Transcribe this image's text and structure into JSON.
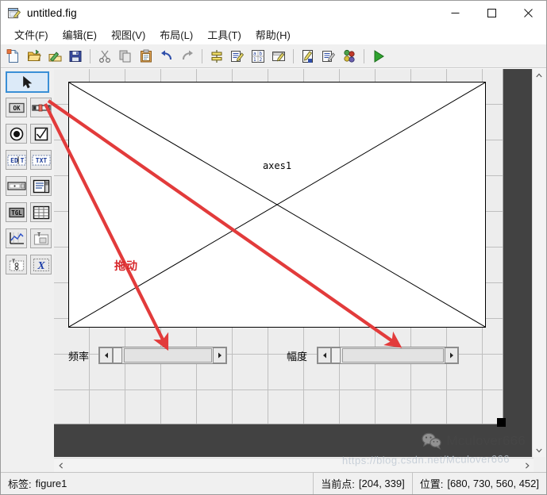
{
  "window": {
    "title": "untitled.fig",
    "icon": "figure-file-icon",
    "minimize": "─",
    "maximize": "□",
    "close": "✕"
  },
  "menubar": {
    "items": [
      {
        "label": "文件(F)",
        "name": "menu-file"
      },
      {
        "label": "编辑(E)",
        "name": "menu-edit"
      },
      {
        "label": "视图(V)",
        "name": "menu-view"
      },
      {
        "label": "布局(L)",
        "name": "menu-layout"
      },
      {
        "label": "工具(T)",
        "name": "menu-tools"
      },
      {
        "label": "帮助(H)",
        "name": "menu-help"
      }
    ]
  },
  "toolbar": {
    "buttons": [
      {
        "name": "new-file-icon",
        "tip": "新建"
      },
      {
        "name": "open-file-icon",
        "tip": "打开"
      },
      {
        "name": "export-icon",
        "tip": "导出"
      },
      {
        "name": "save-icon",
        "tip": "保存"
      },
      {
        "name": "cut-icon",
        "tip": "剪切"
      },
      {
        "name": "copy-icon",
        "tip": "复制"
      },
      {
        "name": "paste-icon",
        "tip": "粘贴"
      },
      {
        "name": "undo-icon",
        "tip": "撤销"
      },
      {
        "name": "redo-icon",
        "tip": "恢复"
      },
      {
        "name": "align-objects-icon",
        "tip": "对齐对象"
      },
      {
        "name": "menu-editor-icon",
        "tip": "菜单编辑器"
      },
      {
        "name": "tab-order-editor-icon",
        "tip": "Tab 顺序编辑器"
      },
      {
        "name": "toolbar-editor-icon",
        "tip": "工具栏编辑器"
      },
      {
        "name": "m-file-editor-icon",
        "tip": "M 文件编辑器"
      },
      {
        "name": "property-inspector-icon",
        "tip": "属性检查器"
      },
      {
        "name": "object-browser-icon",
        "tip": "对象浏览器"
      },
      {
        "name": "run-icon",
        "tip": "运行"
      }
    ]
  },
  "palette": {
    "tools": [
      {
        "name": "select-arrow-tool",
        "glyph": "arrow",
        "selected": true
      },
      {
        "name": "push-button-tool",
        "glyph": "OK",
        "selected": false
      },
      {
        "name": "slider-tool",
        "glyph": "slider",
        "selected": false
      },
      {
        "name": "radio-button-tool",
        "glyph": "radio",
        "selected": false
      },
      {
        "name": "checkbox-tool",
        "glyph": "check",
        "selected": false
      },
      {
        "name": "edit-text-tool",
        "glyph": "EDIT",
        "selected": false
      },
      {
        "name": "static-text-tool",
        "glyph": "TXT",
        "selected": false
      },
      {
        "name": "popup-menu-tool",
        "glyph": "popup",
        "selected": false
      },
      {
        "name": "listbox-tool",
        "glyph": "listbox",
        "selected": false
      },
      {
        "name": "toggle-button-tool",
        "glyph": "TGL",
        "selected": false
      },
      {
        "name": "table-tool",
        "glyph": "table",
        "selected": false
      },
      {
        "name": "axes-tool",
        "glyph": "axes",
        "selected": false
      },
      {
        "name": "panel-tool",
        "glyph": "panel",
        "selected": false
      },
      {
        "name": "button-group-tool",
        "glyph": "buttongroup",
        "selected": false
      },
      {
        "name": "activex-tool",
        "glyph": "X",
        "selected": false
      }
    ]
  },
  "canvas": {
    "axes": {
      "label": "axes1"
    },
    "sliders": [
      {
        "name": "slider-frequency",
        "label": "频率",
        "value": 0
      },
      {
        "name": "slider-amplitude",
        "label": "幅度",
        "value": 0
      }
    ]
  },
  "annotation": {
    "text": "拖动",
    "color": "#d7262a"
  },
  "watermark": {
    "text": "Mculover666",
    "secondary": "https://blog.csdn.net/Mculover666"
  },
  "statusbar": {
    "tag_key": "标签:",
    "tag_value": "figure1",
    "current_point_key": "当前点:",
    "current_point_value": "[204, 339]",
    "position_key": "位置:",
    "position_value": "[680, 730, 560, 452]"
  },
  "scrollbars": {
    "up": "⌃",
    "down": "⌄",
    "left": "‹",
    "right": "›"
  }
}
